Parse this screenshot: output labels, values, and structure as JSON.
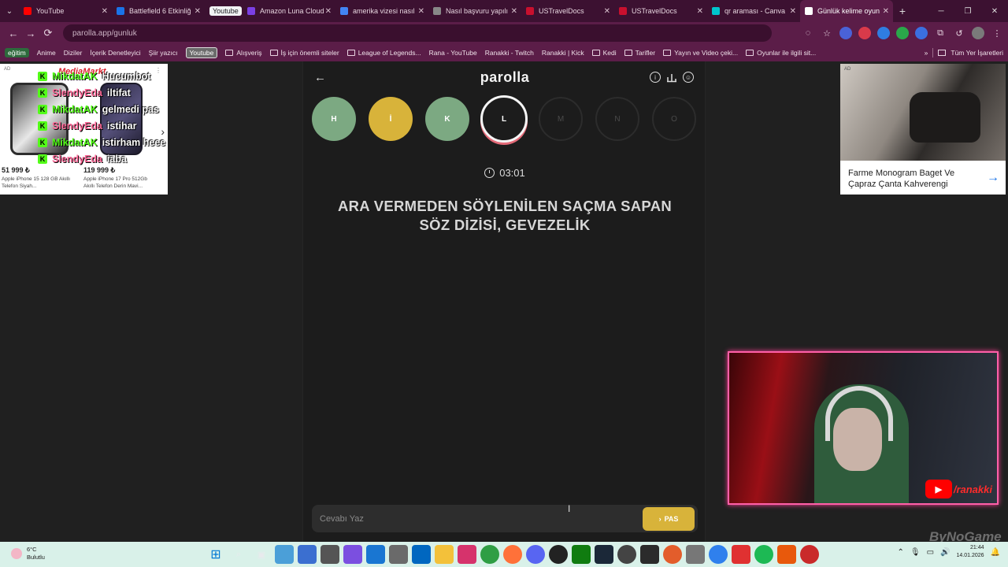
{
  "browser": {
    "tabs": [
      {
        "label": "YouTube",
        "color": "#ff0000",
        "active": false
      },
      {
        "label": "Battlefield 6 Etkinliğ",
        "color": "#1a73e8",
        "active": false
      },
      {
        "label": "Youtube",
        "color": "#ffffff",
        "active": false,
        "chip": true
      },
      {
        "label": "Amazon Luna Cloud",
        "color": "#7b3fe4",
        "active": false
      },
      {
        "label": "amerika vizesi nasıl",
        "color": "#4285f4",
        "active": false
      },
      {
        "label": "Nasıl başvuru yapılı",
        "color": "#888888",
        "active": false
      },
      {
        "label": "USTravelDocs",
        "color": "#c8102e",
        "active": false
      },
      {
        "label": "USTravelDocs",
        "color": "#c8102e",
        "active": false
      },
      {
        "label": "qr araması - Canva",
        "color": "#00c4cc",
        "active": false
      },
      {
        "label": "Günlük kelime oyun",
        "color": "#ffffff",
        "active": true
      }
    ],
    "address": "parolla.app/gunluk",
    "bookmarks": [
      {
        "label": "eğitim",
        "type": "chip"
      },
      {
        "label": "Anime",
        "type": "link"
      },
      {
        "label": "Diziler",
        "type": "link"
      },
      {
        "label": "İçerik Denetleyici",
        "type": "link"
      },
      {
        "label": "Şiir yazıcı",
        "type": "link"
      },
      {
        "label": "Youtube",
        "type": "chip-yt"
      },
      {
        "label": "Alışveriş",
        "type": "folder"
      },
      {
        "label": "İş için önemli siteler",
        "type": "folder"
      },
      {
        "label": "League of Legends...",
        "type": "folder"
      },
      {
        "label": "Rana - YouTube",
        "type": "link"
      },
      {
        "label": "Ranakki - Twitch",
        "type": "link"
      },
      {
        "label": "Ranakki | Kick",
        "type": "link"
      },
      {
        "label": "Kedi",
        "type": "folder"
      },
      {
        "label": "Tarifler",
        "type": "folder"
      },
      {
        "label": "Yayın ve Video çeki...",
        "type": "folder"
      },
      {
        "label": "Oyunlar ile ilgili sit...",
        "type": "folder"
      }
    ],
    "all_bookmarks": "Tüm Yer İşaretleri"
  },
  "ads": {
    "left": {
      "tag": "AD",
      "brand": "MediaMarkt",
      "products": [
        {
          "price": "51 999 ₺",
          "name": "Apple iPhone 15 128 GB Akıllı Telefon Siyah..."
        },
        {
          "price": "119 999 ₺",
          "name": "Apple iPhone 17 Pro 512Gb Akıllı Telefon Derin Mavi..."
        }
      ]
    },
    "right": {
      "tag": "AD",
      "title": "Farme Monogram Baget Ve Çapraz Çanta Kahverengi"
    }
  },
  "game": {
    "logo": "parolla",
    "letters": [
      {
        "letter": "H",
        "state": "correct"
      },
      {
        "letter": "İ",
        "state": "passed"
      },
      {
        "letter": "K",
        "state": "correct"
      },
      {
        "letter": "L",
        "state": "current"
      },
      {
        "letter": "M",
        "state": "upcoming"
      },
      {
        "letter": "N",
        "state": "upcoming"
      },
      {
        "letter": "O",
        "state": "upcoming"
      }
    ],
    "timer": "03:01",
    "question": "ARA VERMEDEN SÖYLENİLEN SAÇMA SAPAN SÖZ DİZİSİ, GEVEZELİK",
    "answer_placeholder": "Cevabı Yaz",
    "pass_label": "PAS"
  },
  "stream": {
    "chat": [
      {
        "user": "MikdatAK",
        "message": "Hucumbot",
        "color": "#53fc18"
      },
      {
        "user": "SlendyEda",
        "message": "iltifat",
        "color": "#ff6b9a"
      },
      {
        "user": "MikdatAK",
        "message": "gelmedi pas",
        "color": "#53fc18"
      },
      {
        "user": "SlendyEda",
        "message": "istihar",
        "color": "#ff6b9a"
      },
      {
        "user": "MikdatAK",
        "message": "istirham heee",
        "color": "#53fc18"
      },
      {
        "user": "SlendyEda",
        "message": "iaba",
        "color": "#ff6b9a"
      }
    ],
    "handle": "/ranakki",
    "watermark": "ByNoGame"
  },
  "taskbar": {
    "temperature": "6°C",
    "weather": "Bulutlu",
    "time": "21:44",
    "date": "14.01.2026"
  }
}
